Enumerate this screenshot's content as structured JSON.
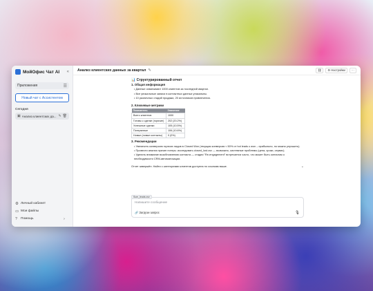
{
  "sidebar": {
    "app_title": "МойОфис Чат AI",
    "collapse_icon": "chevron-left-icon",
    "apps_label": "Приложения",
    "new_chat": "Новый чат с Ассистентом",
    "section_today": "Сегодня",
    "chat_item": "Анализ клиентских да...",
    "bottom": [
      {
        "label": "Личный кабинет",
        "icon": "gear-icon"
      },
      {
        "label": "Мои файлы",
        "icon": "folder-icon"
      },
      {
        "label": "Помощь",
        "icon": "help-icon"
      }
    ]
  },
  "header": {
    "title": "Анализ клиентских данных за квартал",
    "settings_label": "Настройки"
  },
  "report": {
    "heading": "Структурированный отчет",
    "s1_title": "1. Общая информация",
    "s1_items": [
      "Данные охватывают 1000 клиентов за последний квартал.",
      "Все уникальные записи в контактных данных уникальны.",
      "10 различных стадий продажи, 20 источников привлечения."
    ],
    "s2_title": "2. Ключевые метрики",
    "table_headers": [
      "Показатель",
      "Значение"
    ],
    "table_rows": [
      [
        "Всего клиентов",
        "1000"
      ],
      [
        "Готовы к сделке (горячие)",
        "202 (20.2%)"
      ],
      [
        "Успешные сделки",
        "105 (10.5%)"
      ],
      [
        "Потерянные",
        "106 (10.6%)"
      ],
      [
        "Новые (новые контакты)",
        "0 (0%)"
      ]
    ],
    "s3_title": "3. Рекомендации",
    "s3_items": [
      "Увеличить конверсию горячих лидов в Closed Won (текущая конверсия ≈ 50% от hot leads к won – прибыльно, но можно улучшить).",
      "Провести анализ причин потерь: исследовать closed_lost.csv — возможно, системные проблемы (цена, сроки, сервис).",
      "Уделить внимание возобновлению контакта — стадия \"Re-engagement\" встречается часто, что может быть сигналом о необходимости CRM-автоматизации."
    ],
    "tail": "Отчет завершён. Найти с категориями клиентов доступна по ссылкам выше."
  },
  "composer": {
    "file_pill": "Sum_leads.csv",
    "placeholder": "Напишите сообщение",
    "attach_label": "Загрузи запрос"
  }
}
